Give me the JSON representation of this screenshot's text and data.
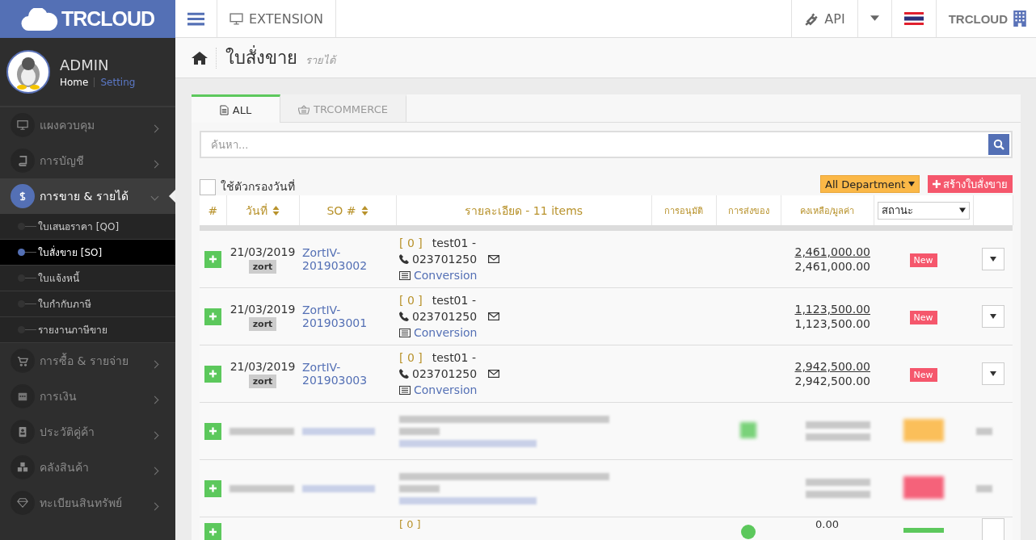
{
  "brand": "TRCLOUD",
  "topbar": {
    "extension": "EXTENSION",
    "api": "API",
    "account": "TRCLOUD"
  },
  "user": {
    "name": "ADMIN",
    "home": "Home",
    "setting": "Setting"
  },
  "sidebar": {
    "items": [
      {
        "label": "แผงควบคุม",
        "selected": false,
        "expanded": false
      },
      {
        "label": "การบัญชี",
        "selected": false,
        "expanded": false
      },
      {
        "label": "การขาย & รายได้",
        "selected": true,
        "expanded": true,
        "children": [
          {
            "label": "ใบเสนอราคา [QO]",
            "selected": false
          },
          {
            "label": "ใบสั่งขาย [SO]",
            "selected": true
          },
          {
            "label": "ใบแจ้งหนี้",
            "selected": false
          },
          {
            "label": "ใบกำกับภาษี",
            "selected": false
          },
          {
            "label": "รายงานภาษีขาย",
            "selected": false
          }
        ]
      },
      {
        "label": "การซื้อ & รายจ่าย",
        "selected": false,
        "expanded": false
      },
      {
        "label": "การเงิน",
        "selected": false,
        "expanded": false
      },
      {
        "label": "ประวัติคู่ค้า",
        "selected": false,
        "expanded": false
      },
      {
        "label": "คลังสินค้า",
        "selected": false,
        "expanded": false
      },
      {
        "label": "ทะเบียนสินทรัพย์",
        "selected": false,
        "expanded": false
      }
    ]
  },
  "page": {
    "title": "ใบสั่งขาย",
    "subtitle": "รายได้"
  },
  "tabs": [
    {
      "label": "ALL",
      "selected": true
    },
    {
      "label": "TRCOMMERCE",
      "selected": false
    }
  ],
  "search": {
    "placeholder": "ค้นหา..."
  },
  "date_filter": {
    "label": "ใช้ตัวกรองวันที่",
    "checked": false
  },
  "department": "All Department",
  "create_button": "สร้างใบสั่งขาย",
  "table": {
    "columns": [
      {
        "label": "#",
        "kind": "text",
        "sortable": false
      },
      {
        "label": "วันที่",
        "kind": "text",
        "sortable": true
      },
      {
        "label": "SO #",
        "kind": "text",
        "sortable": true
      },
      {
        "label": "รายละเอียด - 11 items",
        "kind": "text",
        "sortable": false
      },
      {
        "label": "การอนุมัติ",
        "kind": "small",
        "sortable": false
      },
      {
        "label": "การส่งของ",
        "kind": "small",
        "sortable": false
      },
      {
        "label": "คงเหลือ/มูลค่า",
        "kind": "small",
        "sortable": false
      },
      {
        "label": "สถานะ",
        "kind": "select",
        "sortable": false
      }
    ],
    "rows": [
      {
        "kind": "order",
        "date": "21/03/2019",
        "tag": "zort",
        "so": "ZortIV-201903002",
        "code": "[ 0 ]",
        "customer": "test01 -",
        "phone": "023701250",
        "link": "Conversion",
        "balance": "2,461,000.00",
        "total": "2,461,000.00",
        "status": "New"
      },
      {
        "kind": "order",
        "date": "21/03/2019",
        "tag": "zort",
        "so": "ZortIV-201903001",
        "code": "[ 0 ]",
        "customer": "test01 -",
        "phone": "023701250",
        "link": "Conversion",
        "balance": "1,123,500.00",
        "total": "1,123,500.00",
        "status": "New"
      },
      {
        "kind": "order",
        "date": "21/03/2019",
        "tag": "zort",
        "so": "ZortIV-201903003",
        "code": "[ 0 ]",
        "customer": "test01 -",
        "phone": "023701250",
        "link": "Conversion",
        "balance": "2,942,500.00",
        "total": "2,942,500.00",
        "status": "New"
      },
      {
        "kind": "redacted",
        "delivered": true,
        "color": "#fbbf5a"
      },
      {
        "kind": "redacted",
        "delivered": false,
        "color": "#f5627a"
      },
      {
        "kind": "partial",
        "code": "[ 0 ]",
        "balance": "0.00",
        "delivered": true,
        "color": "#5cc85c"
      }
    ]
  }
}
